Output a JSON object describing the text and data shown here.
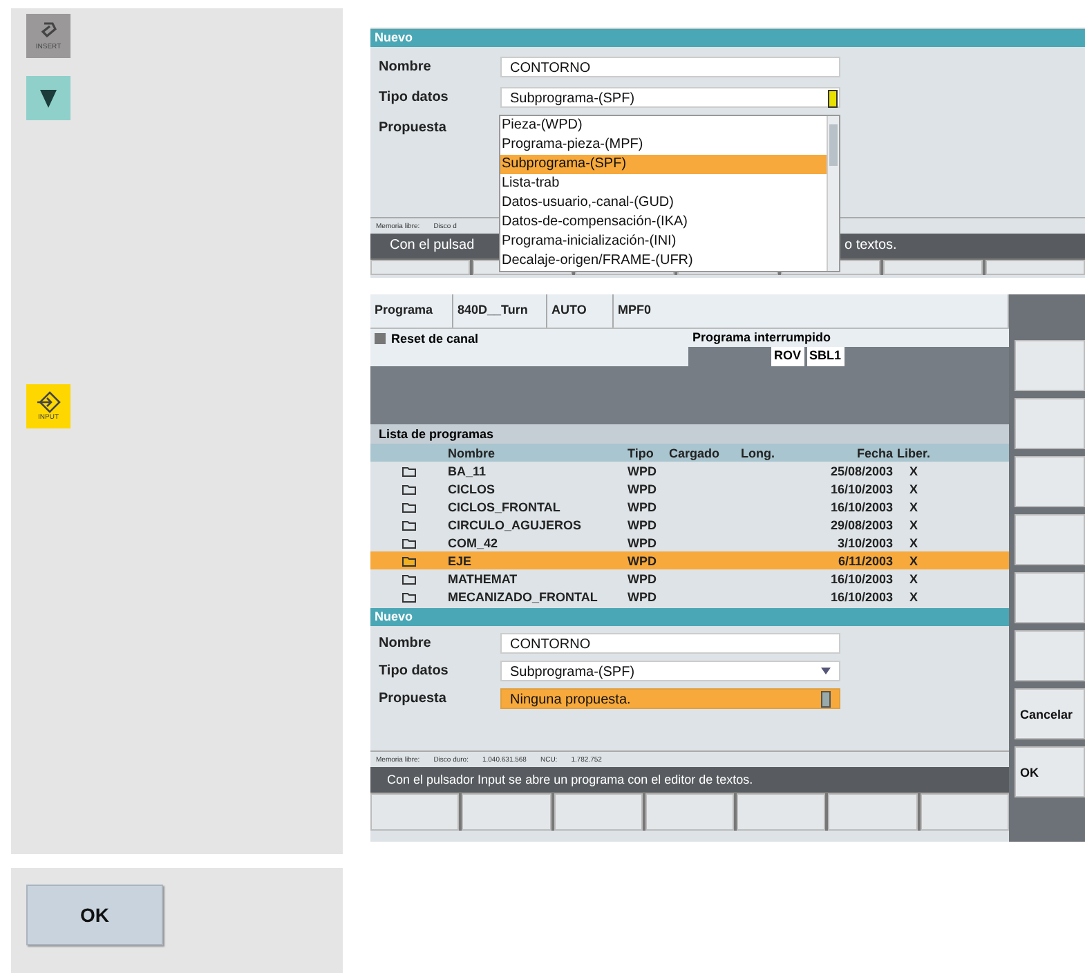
{
  "keys": [
    {
      "kind": "insert",
      "label": "INSERT"
    },
    {
      "kind": "down"
    },
    {
      "kind": "input",
      "label": "INPUT"
    }
  ],
  "ok_button": {
    "label": "OK"
  },
  "screen_1": {
    "dialog": {
      "title": "Nuevo",
      "fields": [
        {
          "label": "Nombre",
          "value": "CONTORNO"
        },
        {
          "label": "Tipo datos",
          "value": "Subprograma-(SPF)"
        },
        {
          "label": "Propuesta"
        }
      ],
      "dropdown": [
        {
          "label": "Pieza-(WPD)",
          "selected": false
        },
        {
          "label": "Programa-pieza-(MPF)",
          "selected": false
        },
        {
          "label": "Subprograma-(SPF)",
          "selected": true
        },
        {
          "label": "Lista-trab",
          "selected": false
        },
        {
          "label": "Datos-usuario,-canal-(GUD)",
          "selected": false
        },
        {
          "label": "Datos-de-compensación-(IKA)",
          "selected": false
        },
        {
          "label": "Programa-inicialización-(INI)",
          "selected": false
        },
        {
          "label": "Decalaje-origen/FRAME-(UFR)",
          "selected": false
        }
      ],
      "memory": [
        "Memoria libre:",
        "Disco d"
      ]
    },
    "status": [
      "Con el pulsad",
      "o textos."
    ]
  },
  "screen_2": {
    "header": {
      "program_label": "Programa",
      "channel": "840D__Turn",
      "mode": "AUTO",
      "program": "MPF0",
      "reset": "Reset de canal",
      "state": "Programa interrumpido",
      "flags": [
        "ROV",
        "SBL1"
      ]
    },
    "list": {
      "title": "Lista de programas",
      "columns": [
        "Nombre",
        "Tipo",
        "Cargado",
        "Long.",
        "Fecha",
        "Liber."
      ],
      "rows": [
        {
          "name": "BA_11",
          "type": "WPD",
          "date": "25/08/2003",
          "liber": "X",
          "selected": false
        },
        {
          "name": "CICLOS",
          "type": "WPD",
          "date": "16/10/2003",
          "liber": "X",
          "selected": false
        },
        {
          "name": "CICLOS_FRONTAL",
          "type": "WPD",
          "date": "16/10/2003",
          "liber": "X",
          "selected": false
        },
        {
          "name": "CIRCULO_AGUJEROS",
          "type": "WPD",
          "date": "29/08/2003",
          "liber": "X",
          "selected": false
        },
        {
          "name": "COM_42",
          "type": "WPD",
          "date": "3/10/2003",
          "liber": "X",
          "selected": false
        },
        {
          "name": "EJE",
          "type": "WPD",
          "date": "6/11/2003",
          "liber": "X",
          "selected": true
        },
        {
          "name": "MATHEMAT",
          "type": "WPD",
          "date": "16/10/2003",
          "liber": "X",
          "selected": false
        },
        {
          "name": "MECANIZADO_FRONTAL",
          "type": "WPD",
          "date": "16/10/2003",
          "liber": "X",
          "selected": false
        }
      ]
    },
    "dialog": {
      "title": "Nuevo",
      "fields": [
        {
          "label": "Nombre",
          "value": "CONTORNO"
        },
        {
          "label": "Tipo datos",
          "value": "Subprograma-(SPF)"
        },
        {
          "label": "Propuesta",
          "value": "Ninguna propuesta."
        }
      ],
      "memory": [
        "Memoria libre:",
        "Disco duro:",
        "1.040.631.568",
        "NCU:",
        "1.782.752"
      ]
    },
    "status": "Con el pulsador Input se abre un programa con el editor de textos.",
    "softkeys": [
      "Cancelar",
      "OK"
    ]
  }
}
